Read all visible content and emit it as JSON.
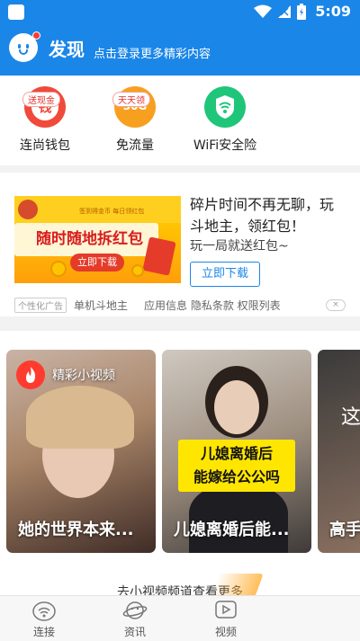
{
  "status_bar": {
    "time": "5:09"
  },
  "header": {
    "title": "发现",
    "subtitle": "点击登录更多精彩内容"
  },
  "tools": [
    {
      "label": "连尚钱包",
      "tag": "送现金",
      "icon_glyph": "钱",
      "icon": "wallet-icon",
      "color": "#f04a3a"
    },
    {
      "label": "免流量",
      "tag": "天天领",
      "icon_glyph": "30G",
      "icon": "data-icon",
      "color": "#f7a020"
    },
    {
      "label": "WiFi安全险",
      "tag": "",
      "icon_glyph": "",
      "icon": "wifi-shield-icon",
      "color": "#1fc67a"
    }
  ],
  "ad": {
    "banner_small_text": "签到得金币 每日领红包",
    "banner_text": "随时随地拆红包",
    "banner_button": "立即下载",
    "title": "碎片时间不再无聊，玩斗地主，领红包！",
    "description": "玩一局就送红包~",
    "button": "立即下载",
    "ad_tag": "个性化广告",
    "app_name": "单机斗地主",
    "links": "应用信息 隐私条款 权限列表",
    "close": "×"
  },
  "videos": {
    "section_label": "精彩小视频",
    "cards": [
      {
        "title": "她的世界本来...",
        "overlay": ""
      },
      {
        "title": "儿媳离婚后能...",
        "overlay_line1": "儿媳离婚后",
        "overlay_line2": "能嫁给公公吗"
      },
      {
        "title": "高手",
        "overlay": "这"
      }
    ],
    "more_link": "去小视频频道查看更多"
  },
  "bottom_nav": [
    {
      "label": "连接",
      "icon": "wifi-icon"
    },
    {
      "label": "资讯",
      "icon": "planet-icon"
    },
    {
      "label": "视频",
      "icon": "play-icon"
    }
  ]
}
